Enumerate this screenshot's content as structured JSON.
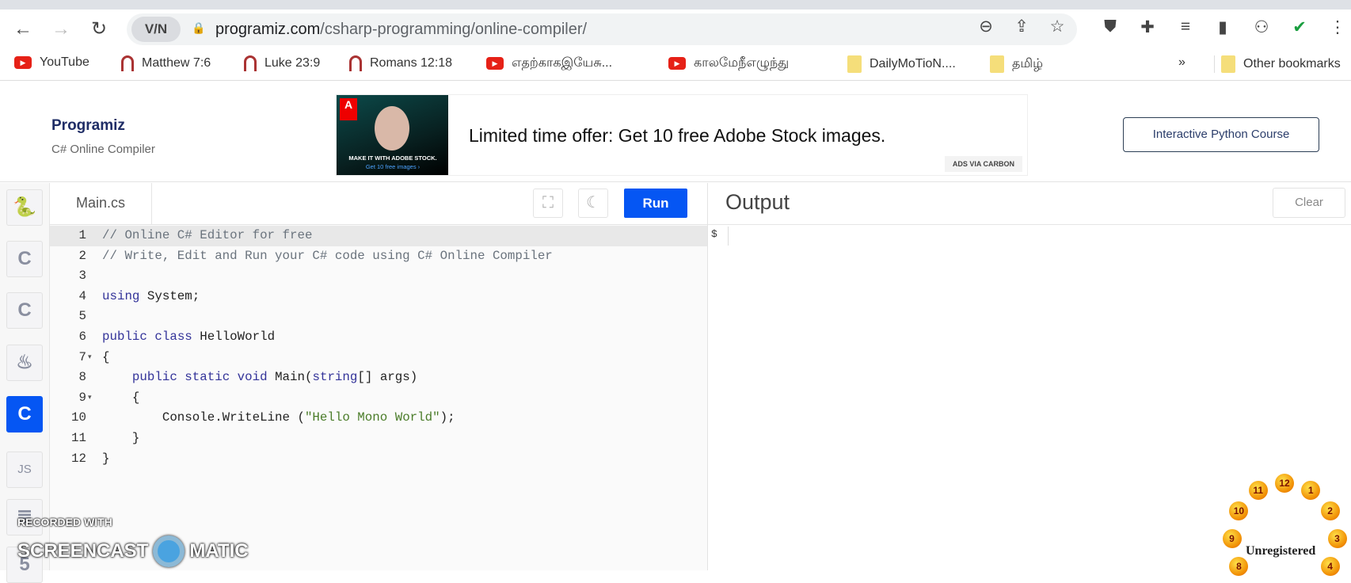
{
  "browser": {
    "vpn_label": "V/N",
    "url_domain": "programiz.com",
    "url_path": "/csharp-programming/online-compiler/",
    "bookmarks": [
      {
        "label": "YouTube",
        "icon": "youtube-icon"
      },
      {
        "label": "Matthew 7:6",
        "icon": "arc-icon"
      },
      {
        "label": "Luke 23:9",
        "icon": "arc-icon"
      },
      {
        "label": "Romans 12:18",
        "icon": "arc-icon"
      },
      {
        "label": "எதற்காகஇயேசு...",
        "icon": "youtube-icon"
      },
      {
        "label": "காலமேநீஎழுந்து",
        "icon": "youtube-icon"
      },
      {
        "label": "DailyMoTioN....",
        "icon": "folder-icon"
      },
      {
        "label": "தமிழ்",
        "icon": "folder-icon"
      }
    ],
    "overflow": "»",
    "other_bookmarks": "Other bookmarks"
  },
  "header": {
    "logo": "Programiz",
    "subtitle": "C# Online Compiler",
    "ad_caption": "MAKE IT WITH ADOBE STOCK.",
    "ad_caption2": "Get 10 free images ›",
    "ad_text": "Limited time offer: Get 10 free Adobe Stock images.",
    "ad_source": "ADS VIA CARBON",
    "course_button": "Interactive Python Course"
  },
  "sidebar": [
    "python",
    "c",
    "cpp",
    "java",
    "csharp",
    "JS",
    "sql",
    "html"
  ],
  "editor": {
    "tab": "Main.cs",
    "run": "Run",
    "lines": [
      {
        "n": "1",
        "html": "<span class='cm'>// Online C# Editor for free</span>"
      },
      {
        "n": "2",
        "html": "<span class='cm'>// Write, Edit and Run your C# code using C# Online Compiler</span>"
      },
      {
        "n": "3",
        "html": ""
      },
      {
        "n": "4",
        "html": "<span class='kw'>using</span> System;"
      },
      {
        "n": "5",
        "html": ""
      },
      {
        "n": "6",
        "html": "<span class='kw'>public</span> <span class='kw'>class</span> HelloWorld"
      },
      {
        "n": "7",
        "html": "{",
        "fold": true
      },
      {
        "n": "8",
        "html": "    <span class='kw'>public</span> <span class='kw'>static</span> <span class='kw'>void</span> Main(<span class='kw'>string</span>[] args)"
      },
      {
        "n": "9",
        "html": "    {",
        "fold": true
      },
      {
        "n": "10",
        "html": "        Console.WriteLine (<span class='st'>\"Hello Mono World\"</span>);"
      },
      {
        "n": "11",
        "html": "    }"
      },
      {
        "n": "12",
        "html": "}"
      }
    ]
  },
  "output": {
    "title": "Output",
    "clear": "Clear",
    "prompt": "$"
  },
  "watermark": {
    "line1": "RECORDED WITH",
    "left": "SCREENCAST",
    "right": "MATIC",
    "clock_label": "Unregistered",
    "clock_numbers": [
      "12",
      "1",
      "2",
      "3",
      "4",
      "8",
      "9",
      "10",
      "11"
    ]
  }
}
